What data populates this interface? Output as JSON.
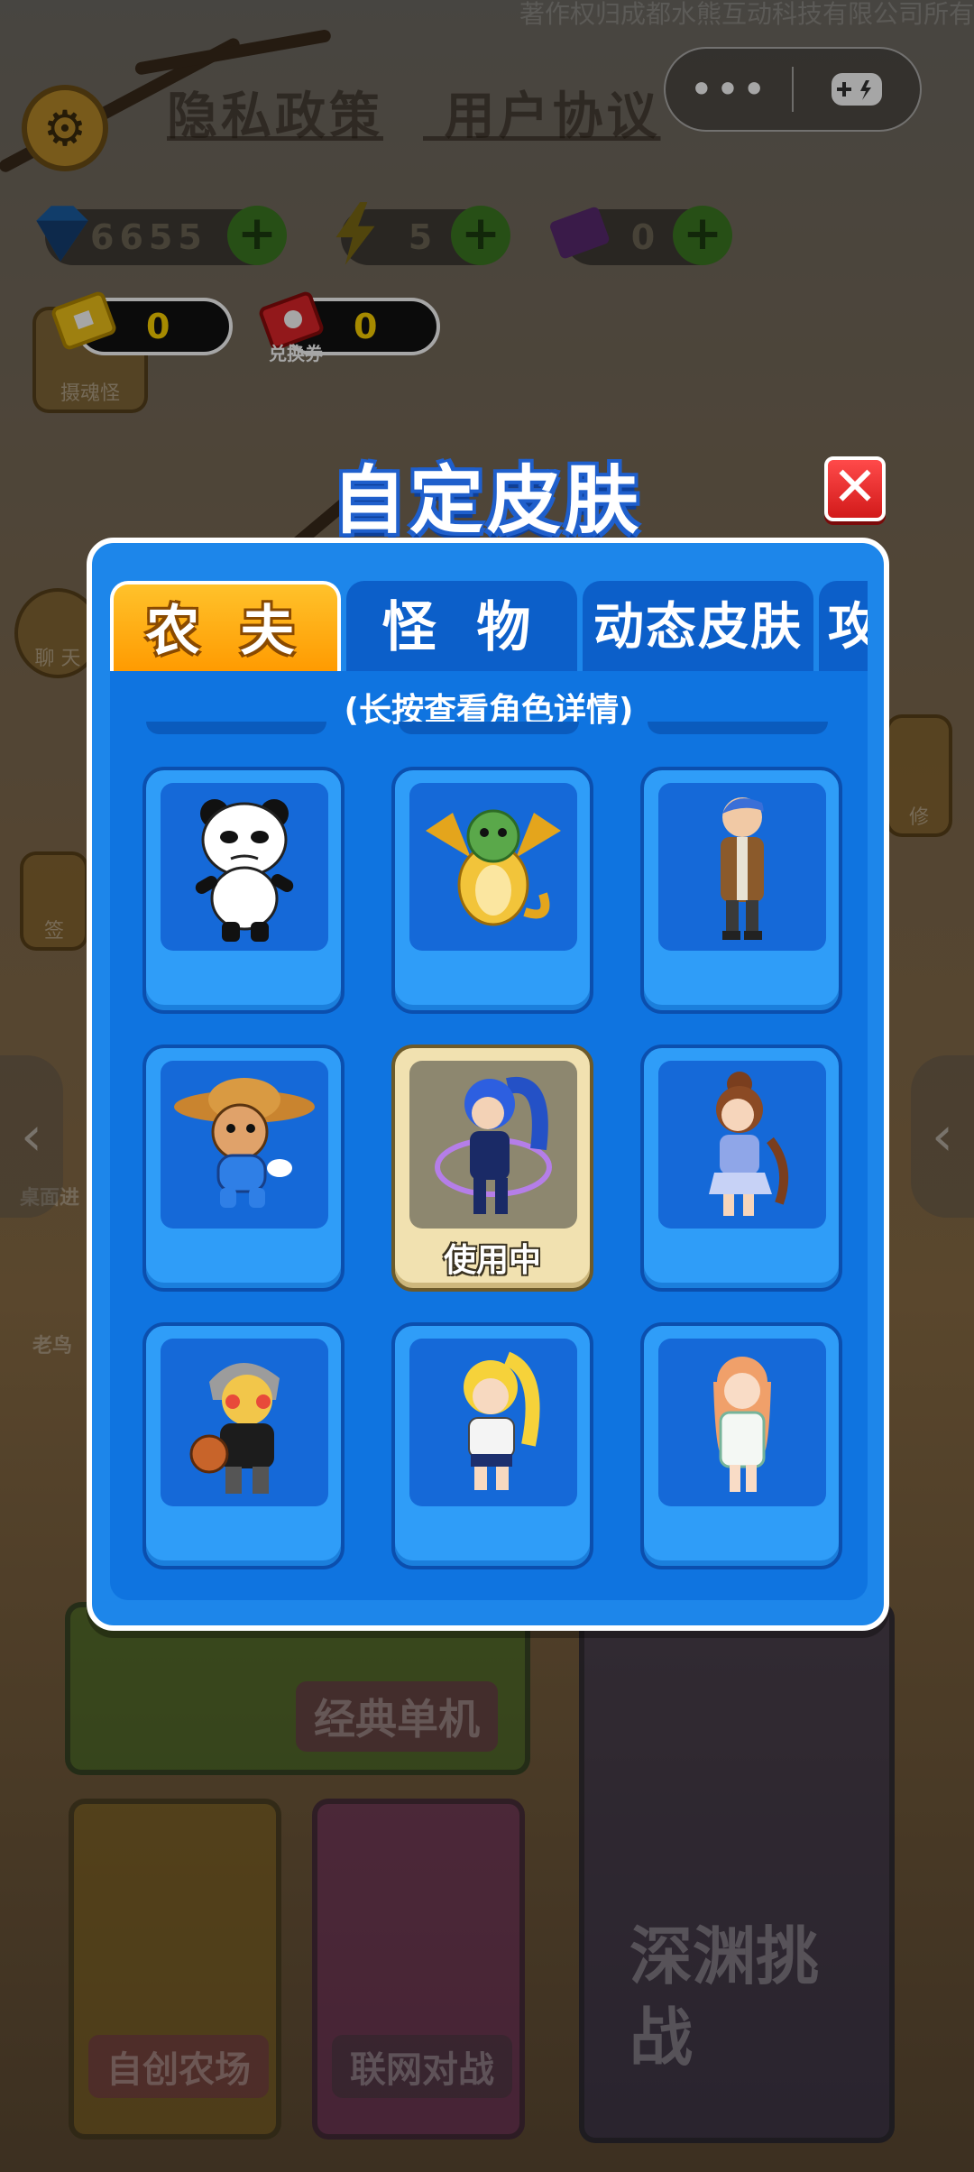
{
  "copyright": "著作权归成都水熊互动科技有限公司所有",
  "policy_links": {
    "privacy": "隐私政策",
    "agreement": "用户协议"
  },
  "resources": {
    "diamonds": "6655",
    "energy": "5",
    "tickets": "0"
  },
  "vouchers": {
    "soul_ticket": "0",
    "exchange_ticket": "0",
    "exchange_label": "兑换券"
  },
  "background_labels": {
    "soul_monster": "摄魂怪",
    "chat": "聊 天",
    "sign": "签",
    "desktop": "桌面进",
    "old_bird": "老鸟",
    "repair": "修",
    "classic_single": "经典单机",
    "custom_farm": "自创农场",
    "online_battle": "联网对战",
    "abyss_challenge": "深渊挑战"
  },
  "modal": {
    "title": "自定皮肤",
    "hint": "(长按查看角色详情)",
    "tabs": [
      {
        "label": "农 夫",
        "active": true
      },
      {
        "label": "怪 物",
        "active": false
      },
      {
        "label": "动态皮肤",
        "active": false
      },
      {
        "label": "攻",
        "active": false
      }
    ],
    "skins": [
      {
        "name": "panda",
        "selected": false,
        "status": ""
      },
      {
        "name": "golden-dragon",
        "selected": false,
        "status": ""
      },
      {
        "name": "blue-hair-coat-man",
        "selected": false,
        "status": ""
      },
      {
        "name": "straw-hat-boy",
        "selected": false,
        "status": ""
      },
      {
        "name": "blue-ponytail-girl",
        "selected": true,
        "status": "使用中"
      },
      {
        "name": "brown-hair-girl",
        "selected": false,
        "status": ""
      },
      {
        "name": "basketball-player",
        "selected": false,
        "status": ""
      },
      {
        "name": "blonde-girl",
        "selected": false,
        "status": ""
      },
      {
        "name": "peach-hair-girl",
        "selected": false,
        "status": ""
      }
    ]
  },
  "colors": {
    "panel_blue": "#1d86ea",
    "tab_active": "#ff9a00",
    "close_red": "#e02424"
  }
}
